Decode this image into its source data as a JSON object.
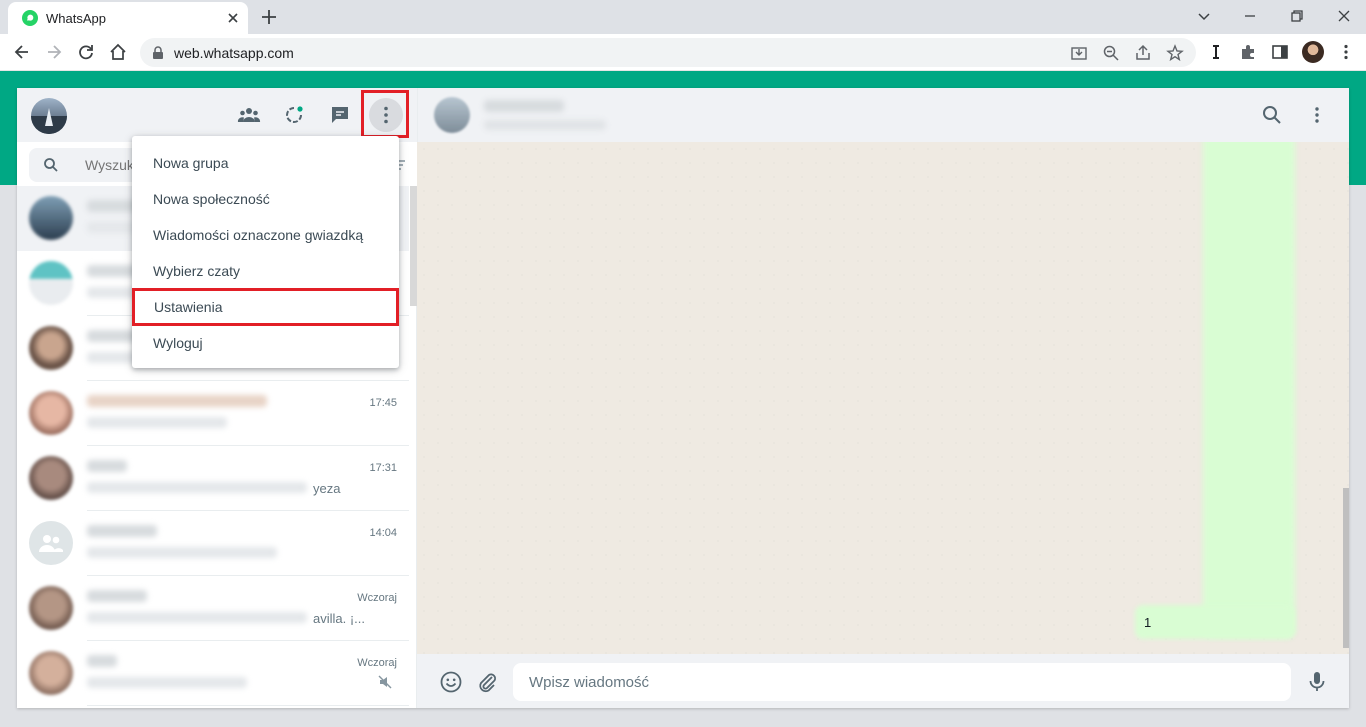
{
  "browser": {
    "tab_title": "WhatsApp",
    "url": "web.whatsapp.com"
  },
  "colors": {
    "brand": "#00a884",
    "highlight": "#e21f26",
    "outgoing_bubble": "#d9fdd3"
  },
  "sidebar": {
    "search_placeholder": "Wyszukaj",
    "header_icons": [
      "community-icon",
      "status-icon",
      "new-chat-icon",
      "menu-icon"
    ]
  },
  "menu": {
    "items": [
      {
        "label": "Nowa grupa"
      },
      {
        "label": "Nowa społeczność"
      },
      {
        "label": "Wiadomości oznaczone gwiazdką"
      },
      {
        "label": "Wybierz czaty"
      },
      {
        "label": "Ustawienia",
        "highlighted": true
      },
      {
        "label": "Wyloguj"
      }
    ]
  },
  "chats": [
    {
      "time": "",
      "preview_tail": ""
    },
    {
      "time": "",
      "preview_tail": ""
    },
    {
      "time": "",
      "preview_tail": ""
    },
    {
      "time": "17:45",
      "preview_tail": ""
    },
    {
      "time": "17:31",
      "preview_tail": "yeza"
    },
    {
      "time": "14:04",
      "preview_tail": ""
    },
    {
      "time": "Wczoraj",
      "preview_tail": "avilla. ¡..."
    },
    {
      "time": "Wczoraj",
      "preview_tail": "",
      "muted": true
    }
  ],
  "conversation": {
    "last_bubble_text": "1",
    "input_placeholder": "Wpisz wiadomość"
  }
}
